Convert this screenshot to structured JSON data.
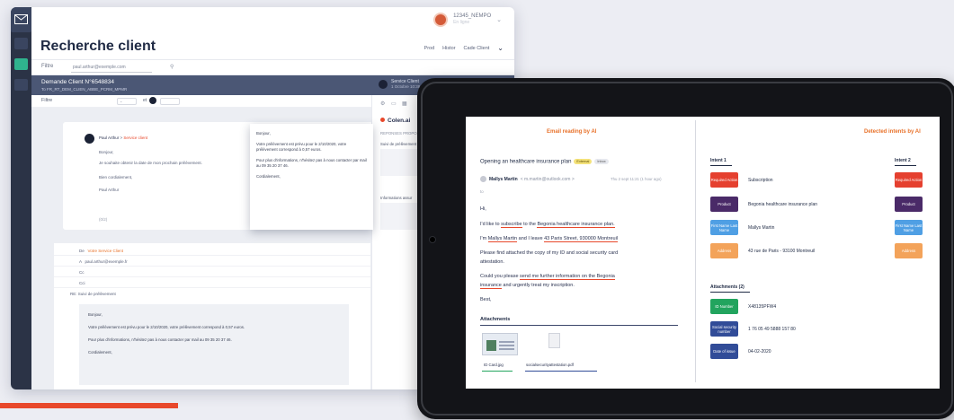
{
  "crm": {
    "user_name": "12345_NEMPO",
    "user_sub": "En ligne",
    "page_title": "Recherche client",
    "nav": [
      "Prod",
      "Histor",
      "Cade Client"
    ],
    "filter_label": "Filtre",
    "filter_value": "paul.arthur@exemple.com",
    "request_title": "Demande Client N°6548834",
    "request_sub": "To FR_RT_DEM_CLIEN_ABBE_PCRM_MPMR",
    "service_name": "Service Client",
    "service_sub": "1 Octobre 10:38",
    "filter2_label": "Filtre",
    "et": "et",
    "card_from": "Paul Arthur",
    "card_service": "Service client",
    "card_lines": [
      "Bonjour,",
      "Je souhaite obtenir la date de mon prochain prélèvement.",
      "Bien cordialement,",
      "Paul Arthur"
    ],
    "card_number": "(0/2)",
    "popup": [
      "Bonjour,",
      "Votre prélèvement est prévu pour le 2/10/2020, votre prélèvement correspond à 0,57 euros.",
      "Pour plus d'informations, n'hésitez pas à nous contacter par mail au 09 35 20 37 46.",
      "Cordialement,"
    ],
    "reply_from": "De",
    "reply_service": "Votre Service Client",
    "reply_to_label": "A",
    "reply_to": "paul.arthur@exemple.fr",
    "reply_cc": "Cc",
    "reply_cci": "Cci",
    "reply_subject": "RE: Suivi de prélèvement",
    "reply_body": [
      "Bonjour,",
      "Votre prélèvement est prévu pour le 2/10/2020, votre prélèvement correspond à 0,57 euros.",
      "Pour plus d'informations, n'hésitez pas à nous contacter par mail au 09 35 20 37 46.",
      "Cordialement,"
    ],
    "right_title": "Colen.ai",
    "right_section": "REPONSES PROPOSÉES",
    "right_item1": "Suivi de prélèvement",
    "right_item2": "Informations assur"
  },
  "tablet": {
    "left_header": "Email reading by AI",
    "right_header": "Detected intents by AI",
    "subject": "Opening an healthcare insurance plan",
    "badge1": "External",
    "badge2": "Inbox",
    "sender": "Mallys Martin",
    "sender_mail": "< m.martin@outlook.com >",
    "when": "Thu 2 sept 11:21 (1 hour ago)",
    "to": "to",
    "lines": [
      "Hi,",
      "I'd like to subscribe to the Begonia healthcare insurance plan.",
      "I'm Mallys Martin and I leave 43 Paris Street, 930000 Montreuil",
      "Please find attached the copy of my ID and social security card",
      "attestation.",
      "Could you please send me further information on the Begonia",
      "insurance and urgently treat my inscription.",
      "Best,"
    ],
    "attachments_label": "Attachments",
    "files": [
      "ID Card.jpg",
      "socialsecurityattestation.pdf"
    ],
    "intent1": "Intent 1",
    "intent2": "Intent 2",
    "tags": [
      "Required Action",
      "Product",
      "First Name Last Name",
      "Address"
    ],
    "values": [
      "Subscription",
      "Begonia healthcare insurance plan",
      "Mallys Martin",
      "43 rue de Paris - 93100 Montreuil"
    ],
    "attachments_title": "Attachments (2)",
    "att_tags": [
      "ID Number",
      "Social security number",
      "Date of issue"
    ],
    "att_values": [
      "X48135PFW4",
      "1 76 05 49 5888 157 80",
      "04-02-2020"
    ]
  },
  "colors": {
    "accent": "#e8482b",
    "navy": "#4b5775",
    "green": "#2fb38e"
  }
}
